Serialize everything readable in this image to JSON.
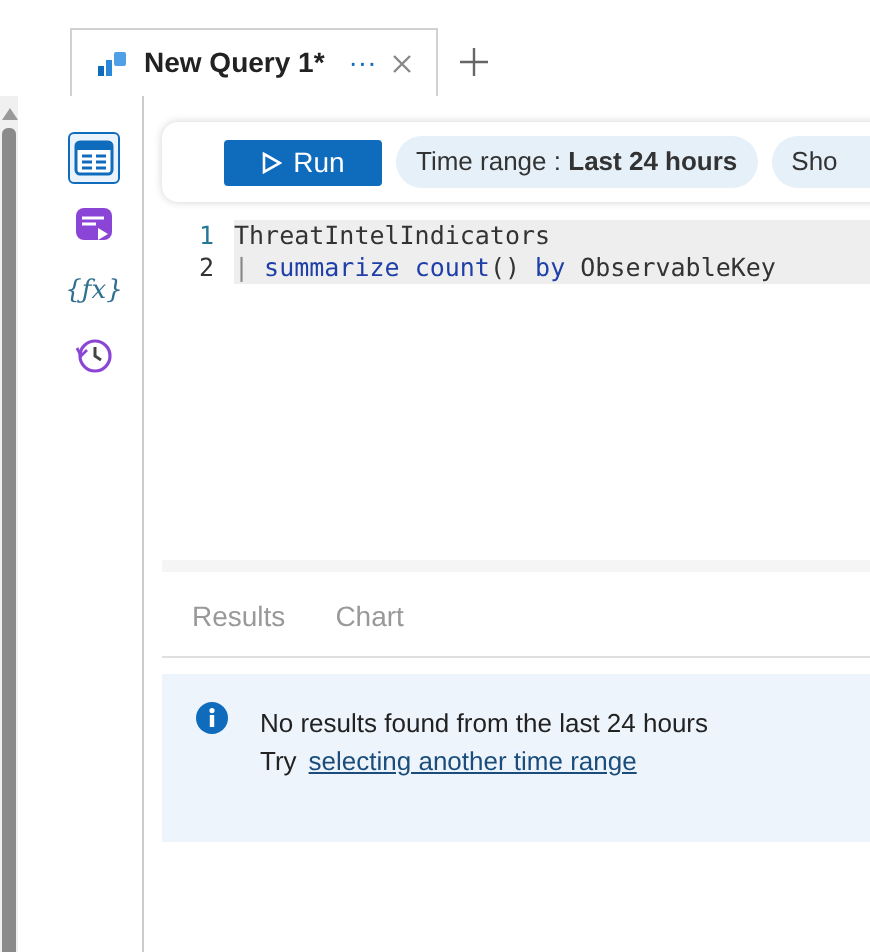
{
  "tab": {
    "title": "New Query 1*",
    "more": "···"
  },
  "rail": [
    {
      "kind": "table",
      "selected": true
    },
    {
      "kind": "media",
      "selected": false
    },
    {
      "kind": "function",
      "glyph": "{ƒx}",
      "selected": false
    },
    {
      "kind": "history",
      "selected": false
    }
  ],
  "toolbar": {
    "run": "Run",
    "time_range_label": "Time range :",
    "time_range_value": "Last 24 hours",
    "pill_3": "Sho"
  },
  "editor": {
    "lines": [
      {
        "number": "1",
        "tokens": [
          {
            "text": "ThreatIntelIndicators",
            "kind": "plain"
          }
        ]
      },
      {
        "number": "2",
        "tokens": [
          {
            "text": "|",
            "kind": "pipe"
          },
          {
            "text": " summarize",
            "kind": "keyword"
          },
          {
            "text": " count",
            "kind": "keyword"
          },
          {
            "text": "()",
            "kind": "plain"
          },
          {
            "text": " by",
            "kind": "keyword"
          },
          {
            "text": " ObservableKey",
            "kind": "plain"
          }
        ]
      }
    ]
  },
  "result_tabs": [
    {
      "label": "Results",
      "selected": false
    },
    {
      "label": "Chart",
      "selected": false
    }
  ],
  "message": {
    "title": "No results found from the last 24 hours",
    "prefix": "Try",
    "link": "selecting another time range"
  }
}
